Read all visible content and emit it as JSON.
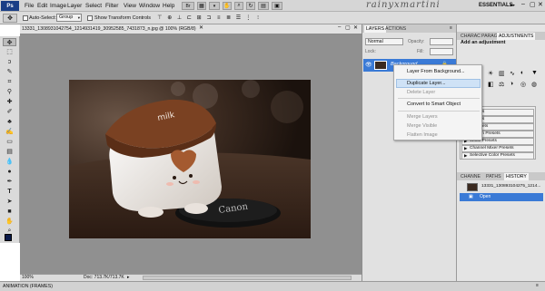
{
  "app": {
    "logo": "Ps",
    "workspace": "ESSENTIALS",
    "brand": "rainyxmartini"
  },
  "menu": [
    "File",
    "Edit",
    "Image",
    "Layer",
    "Select",
    "Filter",
    "View",
    "Window",
    "Help"
  ],
  "options_bar": {
    "auto_select_label": "Auto-Select:",
    "auto_select_value": "Group",
    "transform_label": "Show Transform Controls"
  },
  "document": {
    "tab_title": "13331_1308931042754_1214931419_30952585_7431873_n.jpg @ 100% (RGB/8)",
    "zoom": "100%",
    "doc_size": "Doc: 713.7K/713.7K"
  },
  "layers_panel": {
    "tabs": [
      "LAYERS",
      "ACTIONS"
    ],
    "blend_mode": "Normal",
    "opacity_label": "Opacity:",
    "lock_label": "Lock:",
    "fill_label": "Fill:",
    "layer_name": "Background"
  },
  "context_menu": {
    "items": [
      {
        "label": "Layer From Background...",
        "enabled": true
      },
      {
        "label": "Duplicate Layer...",
        "enabled": true,
        "highlighted": true
      },
      {
        "label": "Delete Layer",
        "enabled": false
      },
      {
        "label": "Convert to Smart Object",
        "enabled": true
      },
      {
        "label": "Merge Layers",
        "enabled": false
      },
      {
        "label": "Merge Visible",
        "enabled": false
      },
      {
        "label": "Flatten Image",
        "enabled": false
      }
    ]
  },
  "adjustments_panel": {
    "tabs": [
      "CHARAC",
      "PARAG",
      "ADJUSTMENTS"
    ],
    "heading": "Add an adjustment",
    "presets": [
      "Presets",
      "Presets",
      "e Presets",
      "turation Presets",
      "White Presets",
      "Channel Mixer Presets",
      "Selective Color Presets"
    ]
  },
  "history_panel": {
    "tabs": [
      "CHANNE",
      "PATHS",
      "HISTORY"
    ],
    "snapshot": "13331_130893104275_1214...",
    "state": "Open"
  },
  "animation": {
    "label": "ANIMATION (FRAMES)"
  },
  "colors": {
    "selection": "#3a7ad6",
    "menu_highlight": "#cfe2f6",
    "panel": "#e1e1e1",
    "canvas": "#909090",
    "foreground": "#0a1a4a"
  }
}
